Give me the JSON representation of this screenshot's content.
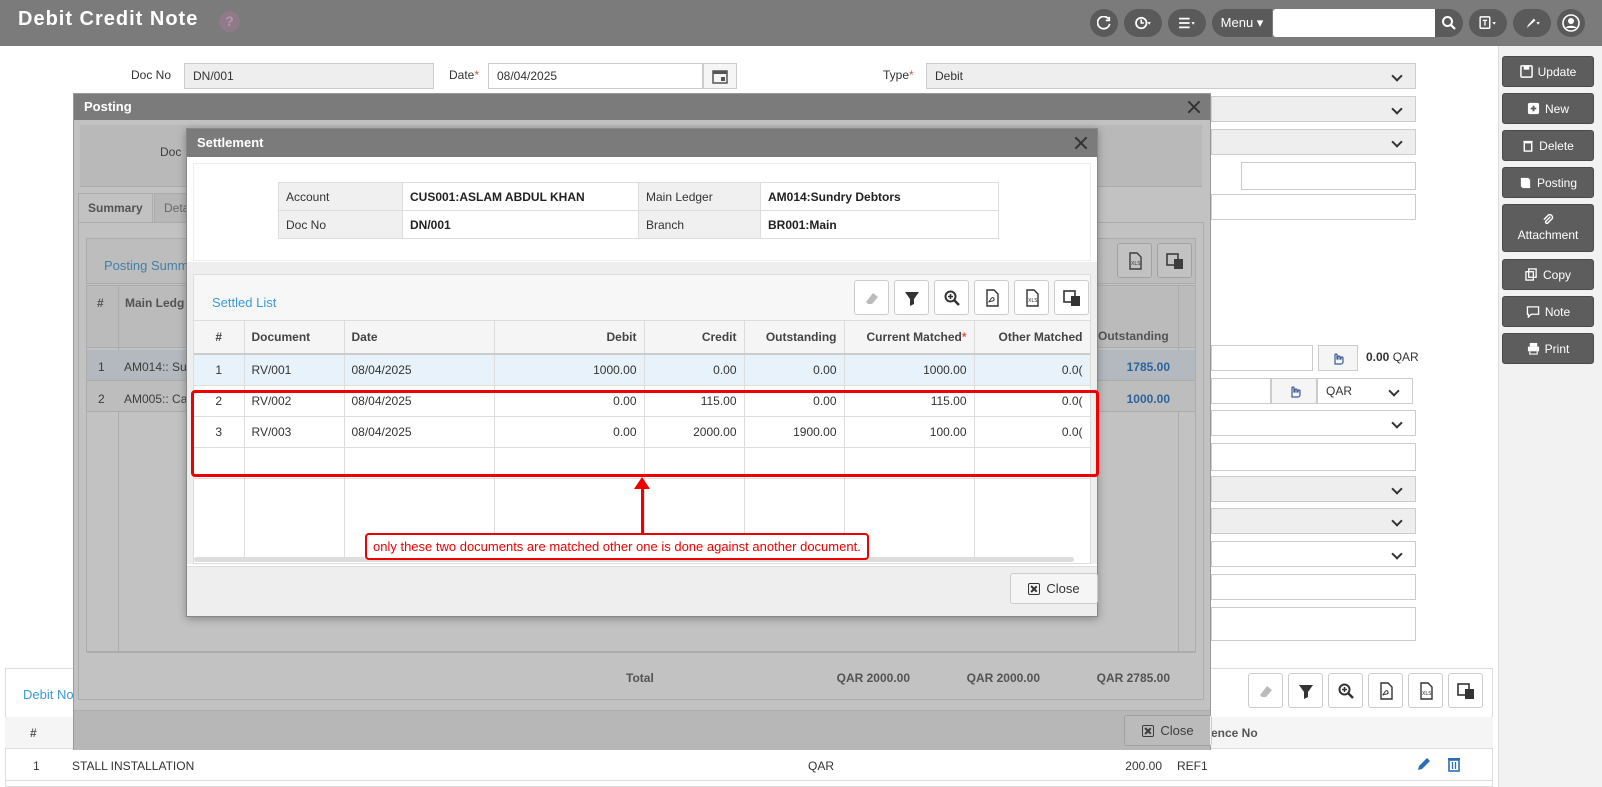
{
  "header": {
    "title": "Debit Credit Note",
    "menu_label": "Menu",
    "search_placeholder": ""
  },
  "form": {
    "doc_no_label": "Doc No",
    "doc_no_value": "DN/001",
    "date_label": "Date",
    "date_value": "08/04/2025",
    "type_label": "Type",
    "type_value": "Debit",
    "amount_value": "0.00",
    "currency": "QAR",
    "currency2": "QAR"
  },
  "side_buttons": [
    {
      "label": "Update"
    },
    {
      "label": "New"
    },
    {
      "label": "Delete"
    },
    {
      "label": "Posting"
    },
    {
      "label": "Attachment"
    },
    {
      "label": "Copy"
    },
    {
      "label": "Note"
    },
    {
      "label": "Print"
    }
  ],
  "bottom_grid": {
    "tab_label": "Debit No",
    "columns": [
      "#",
      "Reference No"
    ],
    "row": {
      "num": "1",
      "desc": "STALL INSTALLATION",
      "currency": "QAR",
      "amount": "200.00",
      "ref": "REF1"
    }
  },
  "posting": {
    "title": "Posting",
    "doc_label": "Doc",
    "tabs": [
      "Summary",
      "Deta"
    ],
    "summary_link": "Posting Summ",
    "columns": [
      "#",
      "Main Ledg",
      "Outstanding"
    ],
    "rows": [
      {
        "num": "1",
        "ledger": "AM014:: Sun",
        "outstanding": "1785.00"
      },
      {
        "num": "2",
        "ledger": "AM005:: Cas",
        "outstanding": "1000.00"
      }
    ],
    "total_label": "Total",
    "totals": [
      "QAR 2000.00",
      "QAR 2000.00",
      "QAR 2785.00"
    ],
    "close_label": "Close"
  },
  "settlement": {
    "title": "Settlement",
    "info": {
      "account_label": "Account",
      "account_value": "CUS001:ASLAM ABDUL KHAN",
      "main_ledger_label": "Main Ledger",
      "main_ledger_value": "AM014:Sundry Debtors",
      "doc_no_label": "Doc No",
      "doc_no_value": "DN/001",
      "branch_label": "Branch",
      "branch_value": "BR001:Main"
    },
    "list_title": "Settled List",
    "columns": [
      "#",
      "Document",
      "Date",
      "Debit",
      "Credit",
      "Outstanding",
      "Current Matched",
      "Other Matched"
    ],
    "rows": [
      {
        "num": "1",
        "doc": "RV/001",
        "date": "08/04/2025",
        "debit": "1000.00",
        "credit": "0.00",
        "outstanding": "0.00",
        "current": "1000.00",
        "other": "0.0("
      },
      {
        "num": "2",
        "doc": "RV/002",
        "date": "08/04/2025",
        "debit": "0.00",
        "credit": "115.00",
        "outstanding": "0.00",
        "current": "115.00",
        "other": "0.0("
      },
      {
        "num": "3",
        "doc": "RV/003",
        "date": "08/04/2025",
        "debit": "0.00",
        "credit": "2000.00",
        "outstanding": "1900.00",
        "current": "100.00",
        "other": "0.0("
      }
    ],
    "close_label": "Close"
  },
  "annotation": {
    "text": "only these two documents are matched other one is done against another document.",
    "color": "#e00000"
  }
}
